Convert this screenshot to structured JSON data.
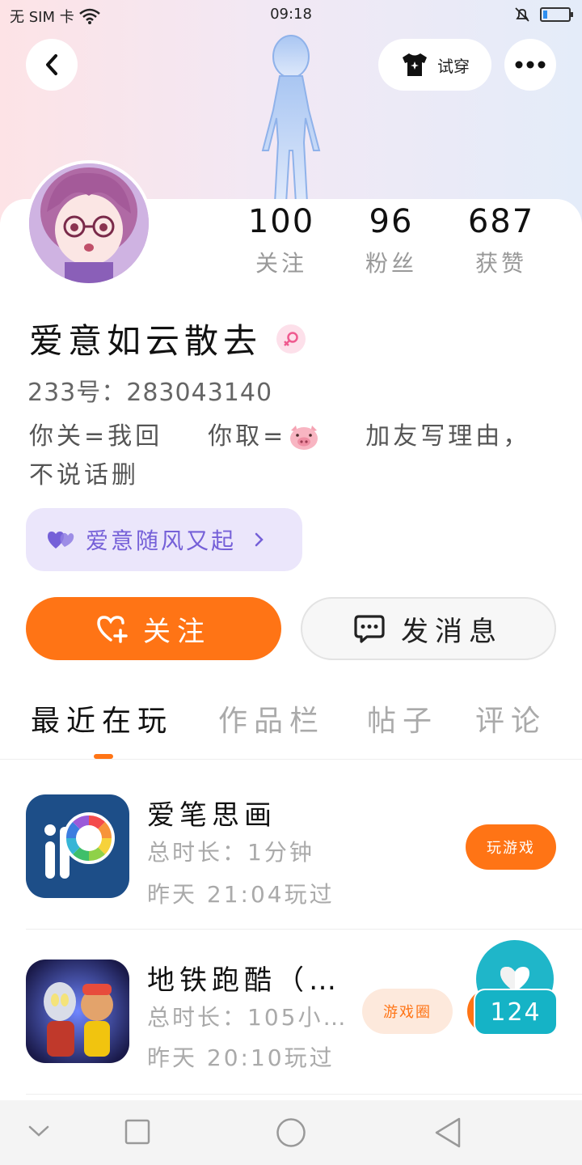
{
  "status_bar": {
    "carrier": "无 SIM 卡",
    "time": "09:18",
    "battery_level": 0.18
  },
  "header": {
    "try_on_label": "试穿"
  },
  "profile": {
    "stats": [
      {
        "value": "100",
        "label": "关注"
      },
      {
        "value": "96",
        "label": "粉丝"
      },
      {
        "value": "687",
        "label": "获赞"
      }
    ],
    "nickname": "爱意如云散去",
    "uid": "233号：283043140",
    "bio_part1": "你关=我回",
    "bio_part2": "你取=",
    "bio_part3": "加友写理由，",
    "bio_line2": "不说话删",
    "tag_label": "爱意随风又起"
  },
  "actions": {
    "follow_label": "关注",
    "message_label": "发消息"
  },
  "tabs": [
    "最近在玩",
    "作品栏",
    "帖子",
    "评论"
  ],
  "games": [
    {
      "name": "爱笔思画",
      "duration": "总时长：1分钟",
      "last_played": "昨天 21:04玩过",
      "button": "玩游戏"
    },
    {
      "name": "地铁跑酷（…",
      "duration": "总时长：105小…",
      "last_played": "昨天 20:10玩过",
      "button": "游戏圈"
    }
  ],
  "floating_like": {
    "count": "124"
  },
  "colors": {
    "accent": "#ff7415",
    "tag_bg": "#ebe6fb",
    "tag_text": "#7560d8",
    "like": "#1fb6c9"
  }
}
